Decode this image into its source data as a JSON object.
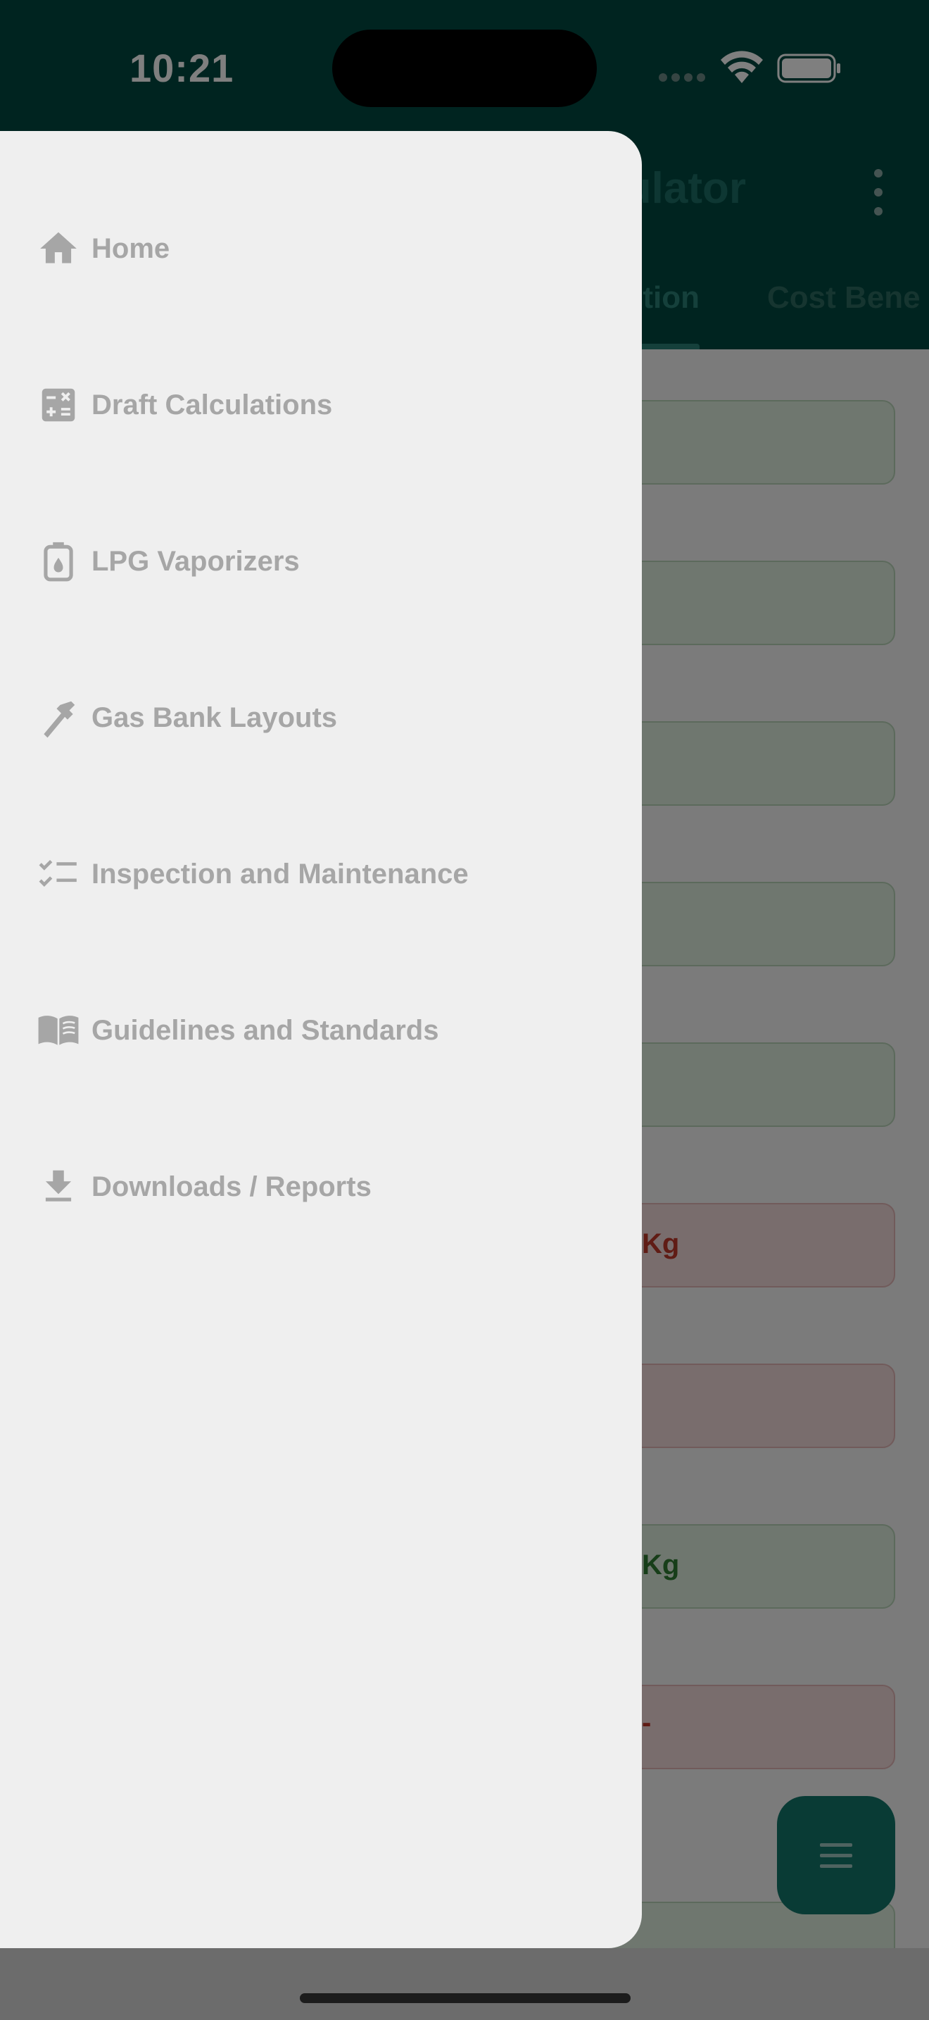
{
  "status_bar": {
    "time": "10:21"
  },
  "app_bar": {
    "title": "ulator",
    "tabs": [
      {
        "label": "tion",
        "active": true
      },
      {
        "label": "Cost Bene",
        "active": false
      }
    ]
  },
  "content": {
    "fields": [
      {
        "text": "",
        "style": "green"
      },
      {
        "text": "",
        "style": "green"
      },
      {
        "text": "",
        "style": "green"
      },
      {
        "text": "",
        "style": "green"
      },
      {
        "text": "",
        "style": "green"
      },
      {
        "text": "Kg",
        "style": "red"
      },
      {
        "text": "",
        "style": "red"
      },
      {
        "text": "Kg",
        "style": "green"
      },
      {
        "text": "-",
        "style": "red"
      },
      {
        "text": "",
        "style": "green"
      }
    ]
  },
  "drawer": {
    "items": [
      {
        "label": "Home",
        "icon": "home-icon"
      },
      {
        "label": "Draft Calculations",
        "icon": "calculator-icon"
      },
      {
        "label": "LPG Vaporizers",
        "icon": "gas-canister-icon"
      },
      {
        "label": "Gas Bank Layouts",
        "icon": "pipe-wrench-icon"
      },
      {
        "label": "Inspection and Maintenance",
        "icon": "checklist-icon"
      },
      {
        "label": "Guidelines and Standards",
        "icon": "book-icon"
      },
      {
        "label": "Downloads / Reports",
        "icon": "download-icon"
      }
    ]
  },
  "colors": {
    "app_bar": "#004940",
    "drawer_bg": "#efefef",
    "drawer_text": "#a6a6a6",
    "fab": "#13766b",
    "red_text": "#c0392b",
    "green_text": "#2e7d32"
  }
}
